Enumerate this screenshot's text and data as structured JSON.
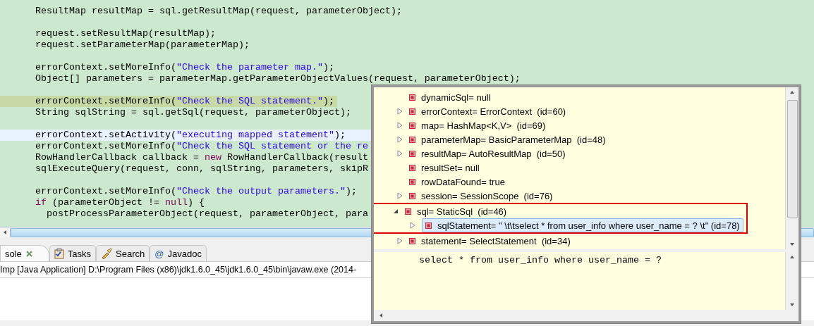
{
  "editor": {
    "lines": [
      {
        "current": false,
        "marked": false,
        "tokens": [
          {
            "kind": "plain",
            "text": "ResultMap resultMap = sql.getResultMap(request, parameterObject);"
          }
        ]
      },
      {
        "kind": "blank"
      },
      {
        "current": false,
        "marked": false,
        "tokens": [
          {
            "kind": "plain",
            "text": "request.setResultMap(resultMap);"
          }
        ]
      },
      {
        "current": false,
        "marked": false,
        "tokens": [
          {
            "kind": "plain",
            "text": "request.setParameterMap(parameterMap);"
          }
        ]
      },
      {
        "kind": "blank"
      },
      {
        "current": false,
        "marked": false,
        "tokens": [
          {
            "kind": "plain",
            "text": "errorContext.setMoreInfo("
          },
          {
            "kind": "string",
            "text": "\"Check the parameter map.\""
          },
          {
            "kind": "plain",
            "text": ");"
          }
        ]
      },
      {
        "current": false,
        "marked": false,
        "tokens": [
          {
            "kind": "plain",
            "text": "Object[] parameters = parameterMap.getParameterObjectValues(request, parameterObject);"
          }
        ]
      },
      {
        "kind": "blank"
      },
      {
        "current": false,
        "marked": true,
        "tokens": [
          {
            "kind": "plain",
            "text": "errorContext.setMoreInfo("
          },
          {
            "kind": "string",
            "text": "\"Check the SQL statement.\""
          },
          {
            "kind": "plain",
            "text": ");"
          }
        ]
      },
      {
        "current": false,
        "marked": false,
        "tokens": [
          {
            "kind": "plain",
            "text": "String sqlString = sql.getSql(request, parameterObject);"
          }
        ]
      },
      {
        "kind": "blank"
      },
      {
        "current": true,
        "marked": false,
        "tokens": [
          {
            "kind": "plain",
            "text": "errorContext.setActivity("
          },
          {
            "kind": "string",
            "text": "\"executing mapped statement\""
          },
          {
            "kind": "plain",
            "text": ");"
          }
        ]
      },
      {
        "current": false,
        "marked": false,
        "tokens": [
          {
            "kind": "plain",
            "text": "errorContext.setMoreInfo("
          },
          {
            "kind": "string",
            "text": "\"Check the SQL statement or the re"
          }
        ]
      },
      {
        "current": false,
        "marked": false,
        "tokens": [
          {
            "kind": "plain",
            "text": "RowHandlerCallback callback = "
          },
          {
            "kind": "keyword",
            "text": "new"
          },
          {
            "kind": "plain",
            "text": " RowHandlerCallback(result"
          }
        ]
      },
      {
        "current": false,
        "marked": false,
        "tokens": [
          {
            "kind": "plain",
            "text": "sqlExecuteQuery(request, conn, sqlString, parameters, skipR"
          }
        ]
      },
      {
        "kind": "blank"
      },
      {
        "current": false,
        "marked": false,
        "tokens": [
          {
            "kind": "plain",
            "text": "errorContext.setMoreInfo("
          },
          {
            "kind": "string",
            "text": "\"Check the output parameters.\""
          },
          {
            "kind": "plain",
            "text": ");"
          }
        ]
      },
      {
        "current": false,
        "marked": false,
        "tokens": [
          {
            "kind": "keyword",
            "text": "if"
          },
          {
            "kind": "plain",
            "text": " (parameterObject != "
          },
          {
            "kind": "keyword",
            "text": "null"
          },
          {
            "kind": "plain",
            "text": ") {"
          }
        ]
      },
      {
        "current": false,
        "marked": false,
        "tokens": [
          {
            "kind": "plain",
            "text": "  postProcessParameterObject(request, parameterObject, para"
          }
        ]
      }
    ]
  },
  "bottom_panel": {
    "tabs": [
      {
        "label": "sole",
        "kind": "console",
        "closable": true,
        "selected": true
      },
      {
        "label": "Tasks",
        "kind": "tasks",
        "closable": false,
        "selected": false
      },
      {
        "label": "Search",
        "kind": "search",
        "closable": false,
        "selected": false
      },
      {
        "label": "Javadoc",
        "kind": "javadoc",
        "glyph": "@",
        "closable": false,
        "selected": false
      }
    ],
    "console_title": "Imp [Java Application] D:\\Program Files (x86)\\jdk1.6.0_45\\jdk1.6.0_45\\bin\\javaw.exe (2014-"
  },
  "variables_popup": {
    "tree": [
      {
        "label": "dynamicSql= null",
        "selected": false,
        "framed": false
      },
      {
        "label": "errorContext= ErrorContext  (id=60)",
        "expanded": false,
        "selected": false,
        "framed": false
      },
      {
        "label": "map= HashMap<K,V>  (id=69)",
        "expanded": false,
        "selected": false,
        "framed": false
      },
      {
        "label": "parameterMap= BasicParameterMap  (id=48)",
        "expanded": false,
        "selected": false,
        "framed": false
      },
      {
        "label": "resultMap= AutoResultMap  (id=50)",
        "expanded": false,
        "selected": false,
        "framed": false
      },
      {
        "label": "resultSet= null",
        "selected": false,
        "framed": false
      },
      {
        "label": "rowDataFound= true",
        "selected": false,
        "framed": false
      },
      {
        "label": "session= SessionScope  (id=76)",
        "expanded": false,
        "selected": false,
        "framed": false
      },
      {
        "label": "sql= StaticSql  (id=46)",
        "expanded": true,
        "selected": false,
        "framed": true,
        "children": [
          {
            "label": "sqlStatement= \" \\t\\tselect * from user_info where user_name = ? \\t\" (id=78)",
            "expanded": false,
            "selected": true,
            "framed": false
          }
        ]
      },
      {
        "label": "statement= SelectStatement  (id=34)",
        "expanded": false,
        "selected": false,
        "framed": false
      }
    ],
    "detail": "\t\tselect * from user_info where user_name = ?"
  }
}
